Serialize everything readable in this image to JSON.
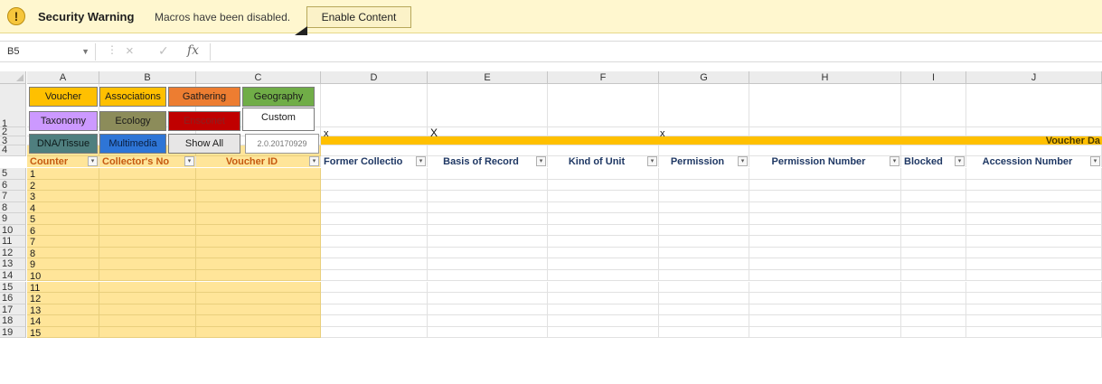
{
  "security_bar": {
    "title": "Security Warning",
    "message": "Macros have been disabled.",
    "enable_button": "Enable Content"
  },
  "formula_bar": {
    "name_box": "B5",
    "cancel_icon": "×",
    "enter_icon": "✓",
    "fx_label": "fx",
    "formula": ""
  },
  "columns": [
    "A",
    "B",
    "C",
    "D",
    "E",
    "F",
    "G",
    "H",
    "I",
    "J"
  ],
  "rows": [
    "1",
    "2",
    "3",
    "4",
    "5",
    "6",
    "7",
    "8",
    "9",
    "10",
    "11",
    "12",
    "13",
    "14",
    "15",
    "16",
    "17",
    "18",
    "19"
  ],
  "macro_buttons": [
    {
      "label": "Voucher",
      "bg": "#ffc000",
      "fg": "#1a1a1a"
    },
    {
      "label": "Associations",
      "bg": "#ffc000",
      "fg": "#1a1a1a"
    },
    {
      "label": "Gathering",
      "bg": "#ed7d31",
      "fg": "#1a1a1a"
    },
    {
      "label": "Geography",
      "bg": "#70ad47",
      "fg": "#1a1a1a"
    },
    {
      "label": "Taxonomy",
      "bg": "#cc99ff",
      "fg": "#1a1a1a"
    },
    {
      "label": "Ecology",
      "bg": "#8c8c5a",
      "fg": "#1a1a1a"
    },
    {
      "label": "Ensconet",
      "bg": "#c00000",
      "fg": "#8b2020"
    },
    {
      "label": "Custom",
      "bg": "#ffffff",
      "fg": "#1a1a1a"
    },
    {
      "label": "DNA/Tissue",
      "bg": "#4f7f7f",
      "fg": "#0d1a1a"
    },
    {
      "label": "Multimedia",
      "bg": "#2e75d6",
      "fg": "#0b1f40"
    },
    {
      "label": "Show All",
      "bg": "#e7e6e6",
      "fg": "#1a1a1a"
    }
  ],
  "version": "2.0.20170929",
  "x_marks": [
    "x",
    "X",
    "x"
  ],
  "banner_title": "Voucher Da",
  "header_row": [
    "Counter",
    "Collector's No",
    "Voucher ID",
    "Former Collectio",
    "Basis of Record",
    "Kind of Unit",
    "Permission",
    "Permission Number",
    "Blocked",
    "Accession Number"
  ],
  "filter_icon": "▾",
  "counter_values": [
    "1",
    "2",
    "3",
    "4",
    "5",
    "6",
    "7",
    "8",
    "9",
    "10",
    "11",
    "12",
    "13",
    "14",
    "15"
  ],
  "colors": {
    "warning_bg": "#fff7cf",
    "banner": "#ffc000",
    "header_text": "#c55a11",
    "yellow_fill": "#ffe599",
    "grid_line": "#e1e1e1"
  }
}
